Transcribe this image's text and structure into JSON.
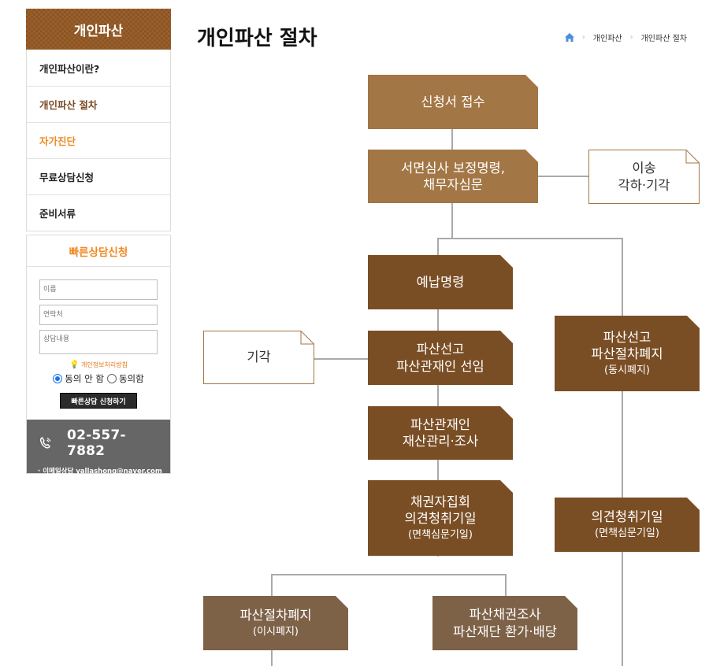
{
  "sidebar": {
    "title": "개인파산",
    "menu": [
      {
        "label": "개인파산이란?"
      },
      {
        "label": "개인파산 절차"
      },
      {
        "label": "자가진단"
      },
      {
        "label": "무료상담신청"
      },
      {
        "label": "준비서류"
      }
    ],
    "quick": {
      "title": "빠른상담신청",
      "name_placeholder": "이름",
      "phone_placeholder": "연락처",
      "content_placeholder": "상담내용",
      "privacy_label": "개인정보처리방침",
      "disagree_label": "동의 안 함",
      "agree_label": "동의함",
      "submit_label": "빠른상담 신청하기"
    },
    "contact": {
      "phone": "02-557-7882",
      "email_line": "· 이메일상담 yallashong@naver.com"
    }
  },
  "header": {
    "page_title": "개인파산 절차",
    "breadcrumb": [
      "개인파산",
      "개인파산 절차"
    ]
  },
  "flow": {
    "n1": "신청서 접수",
    "n2": [
      "서면심사 보정명령,",
      "채무자심문"
    ],
    "r1": [
      "이송",
      "각하·기각"
    ],
    "n3": "예납명령",
    "n4": [
      "파산선고",
      "파산관재인 선임"
    ],
    "l1": "기각",
    "n5": [
      "파산관재인",
      "재산관리·조사"
    ],
    "n6": [
      "채권자집회",
      "의견청취기일"
    ],
    "n6_sub": "(면책심문기일)",
    "r2": [
      "파산선고",
      "파산절차폐지"
    ],
    "r2_sub": "(동시폐지)",
    "r3": "의견청취기일",
    "r3_sub": "(면책심문기일)",
    "b1": "파산절차폐지",
    "b1_sub": "(이시폐지)",
    "b2": [
      "파산채권조사",
      "파산재단 환가·배당"
    ]
  },
  "colors": {
    "light_box": "#a37645",
    "dark_box": "#7a4e25",
    "gray_box": "#7e6248",
    "accent_orange": "#f08a24",
    "connector": "#aaaaaa"
  }
}
